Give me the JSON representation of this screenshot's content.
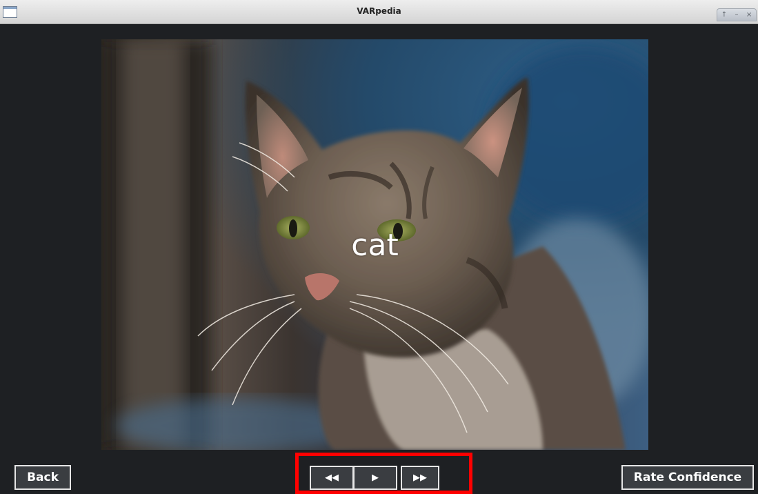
{
  "window": {
    "title": "VARpedia",
    "controls": {
      "up": "↑",
      "minimize": "–",
      "close": "×"
    }
  },
  "viewer": {
    "caption": "cat",
    "image_subject": "tabby cat"
  },
  "buttons": {
    "back": "Back",
    "rewind": "◀◀",
    "play": "▶",
    "forward": "▶▶",
    "rate_confidence": "Rate Confidence"
  },
  "colors": {
    "background": "#1e2023",
    "button_bg": "#3a3d41",
    "button_border": "#e6e6e6",
    "highlight": "#ff0000"
  }
}
